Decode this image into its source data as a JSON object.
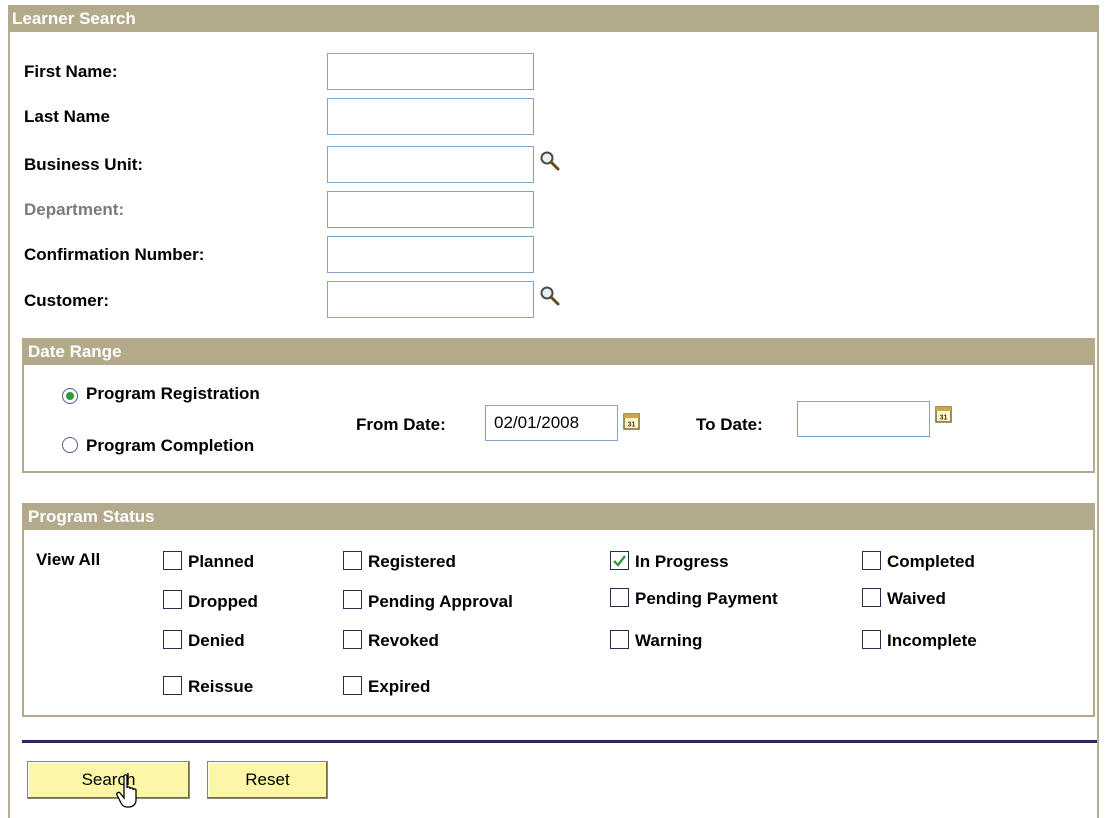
{
  "header": {
    "title": "Learner Search"
  },
  "fields": [
    {
      "label": "First Name:",
      "value": ""
    },
    {
      "label": "Last Name",
      "value": ""
    },
    {
      "label": "Business Unit:",
      "value": "",
      "lookup_icon": "magnifier-icon"
    },
    {
      "label": "Department:",
      "value": "",
      "disabled": true
    },
    {
      "label": "Confirmation Number:",
      "value": ""
    },
    {
      "label": "Customer:",
      "value": "",
      "lookup_icon": "magnifier-icon"
    }
  ],
  "date_range": {
    "title": "Date Range",
    "options": [
      {
        "label": "Program Registration",
        "selected": true
      },
      {
        "label": "Program Completion",
        "selected": false
      }
    ],
    "from_label": "From Date:",
    "from_value": "02/01/2008",
    "to_label": "To Date:",
    "to_value": "",
    "calendar_icon": "calendar-icon"
  },
  "program_status": {
    "title": "Program Status",
    "view_all_label": "View All",
    "statuses": [
      {
        "label": "Planned",
        "checked": false
      },
      {
        "label": "Registered",
        "checked": false
      },
      {
        "label": "In Progress",
        "checked": true
      },
      {
        "label": "Completed",
        "checked": false
      },
      {
        "label": "Dropped",
        "checked": false
      },
      {
        "label": "Pending Approval",
        "checked": false
      },
      {
        "label": "Pending Payment",
        "checked": false
      },
      {
        "label": "Waived",
        "checked": false
      },
      {
        "label": "Denied",
        "checked": false
      },
      {
        "label": "Revoked",
        "checked": false
      },
      {
        "label": "Warning",
        "checked": false
      },
      {
        "label": "Incomplete",
        "checked": false
      },
      {
        "label": "Reissue",
        "checked": false
      },
      {
        "label": "Expired",
        "checked": false
      }
    ]
  },
  "buttons": {
    "search": "Search",
    "reset": "Reset"
  },
  "colors": {
    "header_bg": "#b2aa8b",
    "button_bg": "#fbf7a6",
    "divider": "#27275e",
    "checkmark": "#2f9a3c"
  }
}
